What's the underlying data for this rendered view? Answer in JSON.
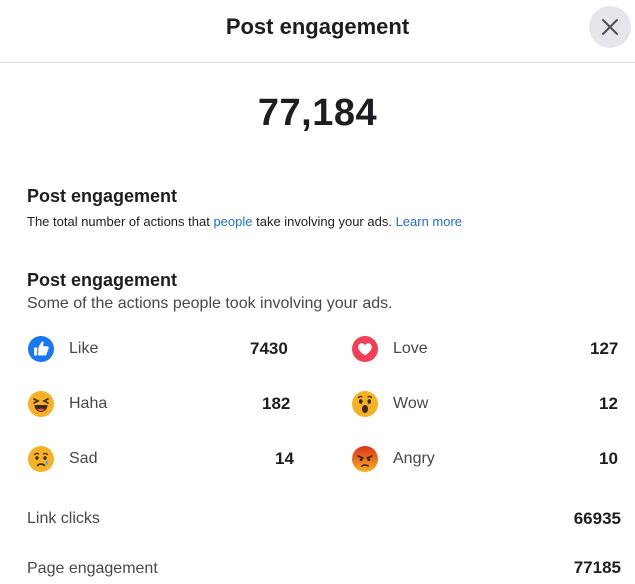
{
  "dialog": {
    "title": "Post engagement",
    "total": "77,184"
  },
  "summary": {
    "heading": "Post engagement",
    "description_before": "The total number of actions that ",
    "description_link": "people",
    "description_after": " take involving your ads. ",
    "learn_more": "Learn more"
  },
  "breakdown": {
    "heading": "Post engagement",
    "description": "Some of the actions people took involving your ads.",
    "reactions": [
      {
        "label": "Like",
        "value": "7430",
        "icon": "like-icon"
      },
      {
        "label": "Love",
        "value": "127",
        "icon": "love-icon"
      },
      {
        "label": "Haha",
        "value": "182",
        "icon": "haha-icon"
      },
      {
        "label": "Wow",
        "value": "12",
        "icon": "wow-icon"
      },
      {
        "label": "Sad",
        "value": "14",
        "icon": "sad-icon"
      },
      {
        "label": "Angry",
        "value": "10",
        "icon": "angry-icon"
      }
    ],
    "link_clicks": {
      "label": "Link clicks",
      "value": "66935"
    },
    "page_engagement": {
      "label": "Page engagement",
      "value": "77185"
    }
  },
  "colors": {
    "link": "#216fdb",
    "like": "#1877f2",
    "love": "#f33e58",
    "emoji_yellow": "#f7b125",
    "angry": "#e9710f"
  }
}
